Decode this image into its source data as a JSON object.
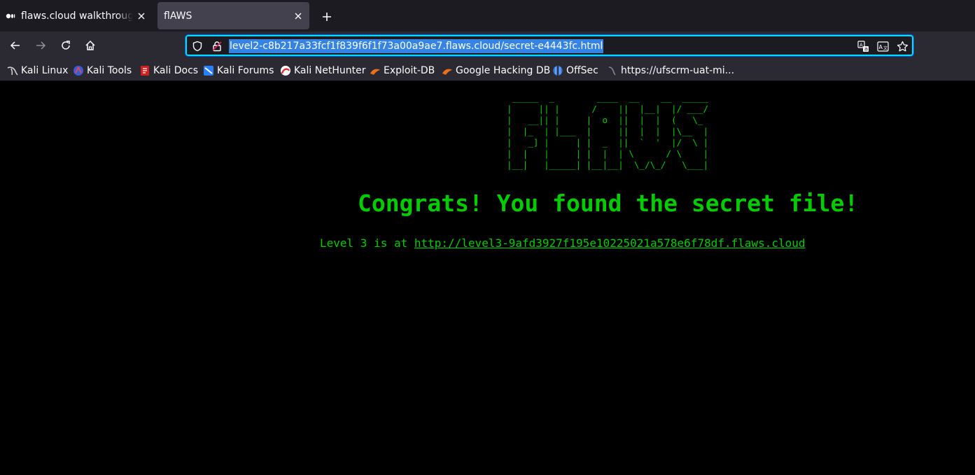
{
  "tabs": [
    {
      "title": "flaws.cloud walkthrough | Mediu",
      "active": false,
      "favicon": "medium-icon"
    },
    {
      "title": "flAWS",
      "active": true,
      "favicon": "none"
    }
  ],
  "tab_close_glyph": "✕",
  "new_tab_glyph": "+",
  "urlbar": {
    "url": "level2-c8b217a33fcf1f839f6f1f73a00a9ae7.flaws.cloud/secret-e4443fc.html",
    "left_icons": [
      "shield-icon",
      "insecure-lock-icon"
    ],
    "right_icons": [
      "translate-icon",
      "translate-page-icon",
      "bookmark-star-icon"
    ]
  },
  "bookmarks": [
    {
      "label": "Kali Linux",
      "icon": "kali-dragon-icon",
      "color": "#d0d0d0"
    },
    {
      "label": "Kali Tools",
      "icon": "kali-tools-icon",
      "color": "#e04a4a"
    },
    {
      "label": "Kali Docs",
      "icon": "kali-docs-icon",
      "color": "#d02020"
    },
    {
      "label": "Kali Forums",
      "icon": "kali-forums-icon",
      "color": "#2a7fff"
    },
    {
      "label": "Kali NetHunter",
      "icon": "kali-nethunter-icon",
      "color": "#e03030"
    },
    {
      "label": "Exploit-DB",
      "icon": "exploit-db-icon",
      "color": "#e8711c"
    },
    {
      "label": "Google Hacking DB",
      "icon": "ghdb-icon",
      "color": "#e8711c"
    },
    {
      "label": "OffSec",
      "icon": "offsec-icon",
      "color": "#3b7ddd"
    },
    {
      "label": "https://ufscrm-uat-mi...",
      "icon": "kali-dragon-icon",
      "color": "#888888"
    }
  ],
  "page": {
    "ascii_art": " _____  _        ____  __    __  _____\n|     || |      /    ||  |__|  |/ ___/\n|   __|| |     |  o  ||  |  |  (   \\_ \n|  |_  | |___  |     ||  |  |  |\\__  |\n|   _] |     | |  _  ||  `  '  |/  \\ |\n|  |   |     | |  |  | \\      / \\    |\n|__|   |_____| |__|__|  \\_/\\_/   \\___|",
    "congrats": "Congrats! You found the secret file!",
    "level_prefix": "Level 3 is at ",
    "level_link": "http://level3-9afd3927f195e10225021a578e6f78df.flaws.cloud",
    "text_color": "#00cc00",
    "background": "#000000"
  }
}
